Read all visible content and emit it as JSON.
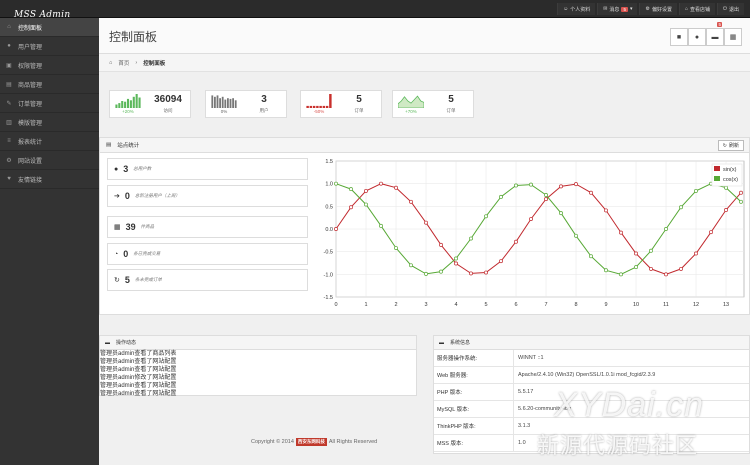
{
  "app": {
    "logo": "MSS Admin"
  },
  "topnav": [
    {
      "icon": "user-icon",
      "glyph": "☺",
      "label": "个人资料"
    },
    {
      "icon": "message-icon",
      "glyph": "✉",
      "label": "消息",
      "badge": "5"
    },
    {
      "icon": "settings-icon",
      "glyph": "⚙",
      "label": "偏好设置"
    },
    {
      "icon": "store-icon",
      "glyph": "⌂",
      "label": "查看店铺"
    },
    {
      "icon": "logout-icon",
      "glyph": "⏻",
      "label": "退出"
    }
  ],
  "sidebar": {
    "items": [
      {
        "label": "控制面板",
        "icon": "home-icon",
        "glyph": "⌂"
      },
      {
        "label": "用户管理",
        "icon": "user-icon",
        "glyph": "●"
      },
      {
        "label": "权限管理",
        "icon": "lock-icon",
        "glyph": "▣"
      },
      {
        "label": "商品管理",
        "icon": "goods-icon",
        "glyph": "▤"
      },
      {
        "label": "订单管理",
        "icon": "order-icon",
        "glyph": "✎"
      },
      {
        "label": "模版管理",
        "icon": "template-icon",
        "glyph": "▥"
      },
      {
        "label": "报表统计",
        "icon": "report-icon",
        "glyph": "≡"
      },
      {
        "label": "网站设置",
        "icon": "gear-icon",
        "glyph": "⚙"
      },
      {
        "label": "友情链接",
        "icon": "link-icon",
        "glyph": "♥"
      }
    ]
  },
  "header": {
    "title": "控制面板",
    "buttons": [
      {
        "icon": "file-icon",
        "glyph": "■"
      },
      {
        "icon": "user-icon",
        "glyph": "●"
      },
      {
        "icon": "comment-icon",
        "glyph": "▬",
        "badge": "5"
      },
      {
        "icon": "cart-icon",
        "glyph": "▦"
      }
    ]
  },
  "breadcrumb": {
    "home": "首页",
    "current": "控制面板"
  },
  "stats": [
    {
      "num": "36094",
      "label": "访问",
      "pct": "+20%",
      "pct_color": "#5cb85c",
      "type": "bars",
      "color": "#5cb85c",
      "levels": [
        0.25,
        0.35,
        0.5,
        0.45,
        0.65,
        0.55,
        0.8,
        1.0,
        0.75
      ]
    },
    {
      "num": "3",
      "label": "用户",
      "pct": "0%",
      "pct_color": "#666666",
      "type": "bars",
      "color": "#777777",
      "levels": [
        0.9,
        0.8,
        0.9,
        0.7,
        0.8,
        0.6,
        0.7,
        0.65,
        0.7,
        0.55
      ]
    },
    {
      "num": "5",
      "label": "订单",
      "pct": "-50%",
      "pct_color": "#d9534f",
      "type": "bars",
      "color": "#c9302c",
      "levels": [
        0.15,
        0.15,
        0.15,
        0.15,
        0.15,
        0.15,
        0.15,
        1.0
      ]
    },
    {
      "num": "5",
      "label": "订单",
      "pct": "+70%",
      "pct_color": "#5cb85c",
      "type": "area",
      "color": "#5cb85c",
      "levels": [
        0.3,
        0.5,
        0.8,
        0.5,
        0.35,
        0.6,
        0.85,
        0.5,
        0.4
      ]
    }
  ],
  "site_stats": {
    "title": "站点统计",
    "refresh": "刷新",
    "quick": [
      {
        "icon": "user-icon",
        "glyph": "●",
        "num": "3",
        "text": "总用户数"
      },
      {
        "icon": "arrow-right-icon",
        "glyph": "➔",
        "num": "0",
        "text": "总新注册用户（上周）"
      },
      {
        "icon": "cart-icon",
        "glyph": "▦",
        "num": "39",
        "text": "件商品"
      },
      {
        "icon": "clock-icon",
        "glyph": "◔",
        "num": "0",
        "text": "条已完成交易"
      },
      {
        "icon": "refresh-icon",
        "glyph": "↻",
        "num": "5",
        "text": "条未完成订单"
      }
    ]
  },
  "chart_data": {
    "type": "line",
    "x": [
      0,
      0.5,
      1,
      1.5,
      2,
      2.5,
      3,
      3.5,
      4,
      4.5,
      5,
      5.5,
      6,
      6.5,
      7,
      7.5,
      8,
      8.5,
      9,
      9.5,
      10,
      10.5,
      11,
      11.5,
      12,
      12.5,
      13,
      13.5
    ],
    "series": [
      {
        "name": "sin(x)",
        "color": "#c1292e",
        "values": [
          0,
          0.48,
          0.84,
          1.0,
          0.91,
          0.6,
          0.14,
          -0.35,
          -0.76,
          -0.98,
          -0.96,
          -0.71,
          -0.28,
          0.22,
          0.66,
          0.94,
          0.99,
          0.8,
          0.41,
          -0.08,
          -0.54,
          -0.88,
          -1.0,
          -0.88,
          -0.54,
          -0.07,
          0.42,
          0.8
        ]
      },
      {
        "name": "cos(x)",
        "color": "#57a835",
        "values": [
          1,
          0.88,
          0.54,
          0.07,
          -0.42,
          -0.8,
          -0.99,
          -0.94,
          -0.65,
          -0.21,
          0.28,
          0.71,
          0.96,
          0.98,
          0.75,
          0.35,
          -0.15,
          -0.6,
          -0.91,
          -1.0,
          -0.84,
          -0.48,
          0.0,
          0.48,
          0.84,
          1.0,
          0.91,
          0.6
        ]
      }
    ],
    "xlim": [
      0,
      13.6
    ],
    "ylim": [
      -1.5,
      1.5
    ],
    "xticks": [
      0,
      1,
      2,
      3,
      4,
      5,
      6,
      7,
      8,
      9,
      10,
      11,
      12,
      13
    ],
    "yticks": [
      1.5,
      1.0,
      0.5,
      0.0,
      -0.5,
      -1.0,
      -1.5
    ],
    "ytick_labels": [
      "1.5",
      "1.0",
      "0.5",
      "0.0",
      "-0.5",
      "-1.0",
      "-1.5"
    ],
    "grid": true,
    "legend": "top-right"
  },
  "activity": {
    "title": "操作动态",
    "lines": [
      "管理员admin查看了商品列表",
      "管理员admin查看了网站配置",
      "管理员admin查看了网站配置",
      "管理员admin修改了网站配置",
      "管理员admin查看了网站配置",
      "管理员admin查看了网站配置"
    ]
  },
  "sysinfo": {
    "title": "系统信息",
    "rows": [
      {
        "k": "服务器操作系统:",
        "v": "WINNT ::1"
      },
      {
        "k": "Web 服务器:",
        "v": "Apache/2.4.10 (Win32) OpenSSL/1.0.1i mod_fcgid/2.3.9"
      },
      {
        "k": "PHP 版本:",
        "v": "5.5.17"
      },
      {
        "k": "MySQL 版本:",
        "v": "5.6.20-community-log"
      },
      {
        "k": "ThinkPHP 版本:",
        "v": "3.1.3"
      },
      {
        "k": "MSS 版本:",
        "v": "1.0"
      }
    ]
  },
  "footer": {
    "copyright": "Copyright © 2014",
    "link": "西安东网科技",
    "rights": "All Rights Reserved"
  },
  "watermark": {
    "line1": "XYDai.cn",
    "line2": "新源代源码社区"
  }
}
